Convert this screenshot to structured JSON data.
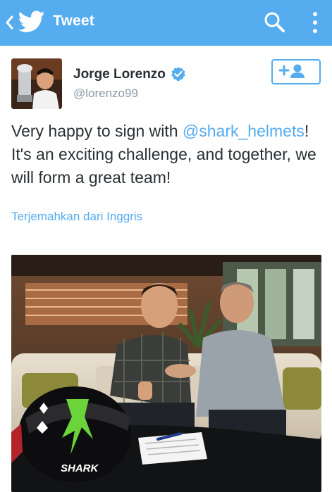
{
  "appbar": {
    "title": "Tweet",
    "back_icon": "chevron-left-icon",
    "logo_icon": "twitter-bird-icon",
    "search_icon": "search-icon",
    "overflow_icon": "more-vertical-icon",
    "color": "#55acee"
  },
  "tweet": {
    "author_name": "Jorge Lorenzo",
    "handle": "@lorenzo99",
    "verified": true,
    "follow_icon": "add-user-icon",
    "text_before": "Very happy to sign with ",
    "mention": "@shark_helmets",
    "text_after": "! It's an exciting challenge, and together, we will form a great team!",
    "translate_label": "Terjemahkan dari Inggris",
    "helmet_brand": "SHARK"
  }
}
